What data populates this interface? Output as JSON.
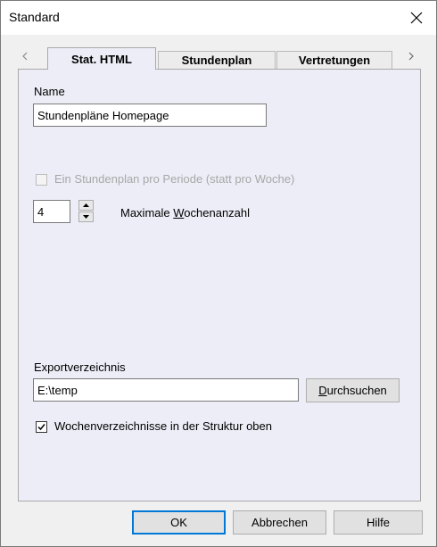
{
  "window": {
    "title": "Standard"
  },
  "tabs": [
    {
      "label": "Stat. HTML",
      "active": true
    },
    {
      "label": "Stundenplan",
      "active": false
    },
    {
      "label": "Vertretungen",
      "active": false
    }
  ],
  "form": {
    "name_label": "Name",
    "name_value": "Stundenpläne Homepage",
    "period_checkbox_label": "Ein Stundenplan pro Periode (statt pro Woche)",
    "period_checkbox_checked": false,
    "period_checkbox_enabled": false,
    "weeks_value": "4",
    "weeks_label_pre": "Maximale ",
    "weeks_label_mnemonic": "W",
    "weeks_label_post": "ochenanzahl",
    "export_label": "Exportverzeichnis",
    "export_value": "E:\\temp",
    "browse_mnemonic": "D",
    "browse_rest": "urchsuchen",
    "structure_checkbox_label": "Wochenverzeichnisse in der Struktur oben",
    "structure_checkbox_checked": true
  },
  "footer": {
    "ok_label": "OK",
    "cancel_label": "Abbrechen",
    "help_label": "Hilfe"
  },
  "colors": {
    "panel_bg": "#ededf7",
    "window_bg": "#f0f0f0",
    "default_button_border": "#0078d7"
  }
}
